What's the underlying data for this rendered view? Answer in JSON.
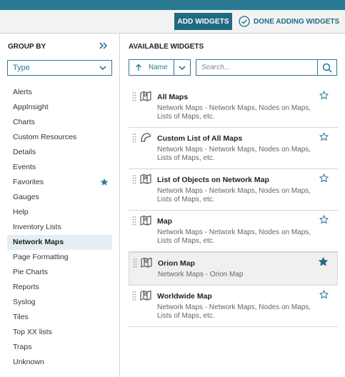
{
  "toolbar": {
    "add_widgets_label": "ADD WIDGETS",
    "done_label": "DONE ADDING WIDGETS"
  },
  "sidebar": {
    "title": "GROUP BY",
    "select_value": "Type",
    "items": [
      {
        "label": "Alerts"
      },
      {
        "label": "AppInsight"
      },
      {
        "label": "Charts"
      },
      {
        "label": "Custom Resources"
      },
      {
        "label": "Details"
      },
      {
        "label": "Events"
      },
      {
        "label": "Favorites",
        "icon": "star-filled-icon"
      },
      {
        "label": "Gauges"
      },
      {
        "label": "Help"
      },
      {
        "label": "Inventory Lists"
      },
      {
        "label": "Network Maps",
        "active": true
      },
      {
        "label": "Page Formatting"
      },
      {
        "label": "Pie Charts"
      },
      {
        "label": "Reports"
      },
      {
        "label": "Syslog"
      },
      {
        "label": "Tiles"
      },
      {
        "label": "Top XX lists"
      },
      {
        "label": "Traps"
      },
      {
        "label": "Unknown"
      }
    ]
  },
  "main": {
    "title": "AVAILABLE WIDGETS",
    "sort_label": "Name",
    "search_placeholder": "Search...",
    "widgets": [
      {
        "title": "All Maps",
        "desc": "Network Maps - Network Maps, Nodes on Maps, Lists of Maps, etc.",
        "icon": "map-icon",
        "favorite": false
      },
      {
        "title": "Custom List of All Maps",
        "desc": "Network Maps - Network Maps, Nodes on Maps, Lists of Maps, etc.",
        "icon": "custom-shape-icon",
        "favorite": false
      },
      {
        "title": "List of Objects on Network Map",
        "desc": "Network Maps - Network Maps, Nodes on Maps, Lists of Maps, etc.",
        "icon": "map-icon",
        "favorite": false
      },
      {
        "title": "Map",
        "desc": "Network Maps - Network Maps, Nodes on Maps, Lists of Maps, etc.",
        "icon": "map-icon",
        "favorite": false
      },
      {
        "title": "Orion Map",
        "desc": "Network Maps - Orion Map",
        "icon": "map-icon",
        "favorite": true
      },
      {
        "title": "Worldwide Map",
        "desc": "Network Maps - Network Maps, Nodes on Maps, Lists of Maps, etc.",
        "icon": "map-icon",
        "favorite": false
      }
    ]
  },
  "colors": {
    "accent": "#2b7a94",
    "button_bg": "#1f6b82"
  }
}
